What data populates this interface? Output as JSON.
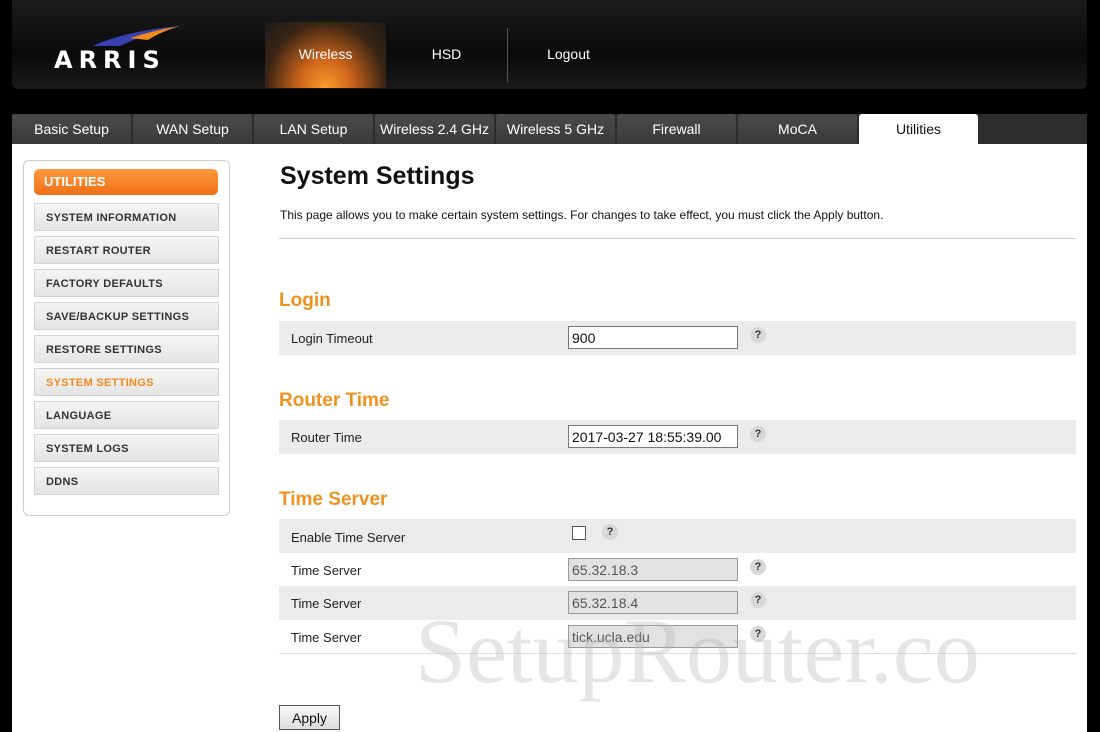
{
  "brand": {
    "logo_text": "ARRIS",
    "accent_color": "#f0911e"
  },
  "top_nav": [
    {
      "label": "Wireless",
      "active": true
    },
    {
      "label": "HSD",
      "active": false
    },
    {
      "label": "Logout",
      "active": false
    }
  ],
  "tabs": [
    {
      "label": "Basic Setup",
      "active": false
    },
    {
      "label": "WAN Setup",
      "active": false
    },
    {
      "label": "LAN Setup",
      "active": false
    },
    {
      "label": "Wireless 2.4 GHz",
      "active": false
    },
    {
      "label": "Wireless 5 GHz",
      "active": false
    },
    {
      "label": "Firewall",
      "active": false
    },
    {
      "label": "MoCA",
      "active": false
    },
    {
      "label": "Utilities",
      "active": true
    }
  ],
  "sidebar": {
    "heading": "UTILITIES",
    "items": [
      {
        "label": "SYSTEM INFORMATION",
        "active": false
      },
      {
        "label": "RESTART ROUTER",
        "active": false
      },
      {
        "label": "FACTORY DEFAULTS",
        "active": false
      },
      {
        "label": "SAVE/BACKUP SETTINGS",
        "active": false
      },
      {
        "label": "RESTORE SETTINGS",
        "active": false
      },
      {
        "label": "SYSTEM SETTINGS",
        "active": true
      },
      {
        "label": "LANGUAGE",
        "active": false
      },
      {
        "label": "SYSTEM LOGS",
        "active": false
      },
      {
        "label": "DDNS",
        "active": false
      }
    ]
  },
  "main": {
    "title": "System Settings",
    "description": "This page allows you to make certain system settings. For changes to take effect, you must click the Apply button.",
    "login": {
      "heading": "Login",
      "timeout_label": "Login Timeout",
      "timeout_value": "900"
    },
    "router_time": {
      "heading": "Router Time",
      "label": "Router Time",
      "value": "2017-03-27 18:55:39.00"
    },
    "time_server": {
      "heading": "Time Server",
      "enable_label": "Enable Time Server",
      "enabled": false,
      "servers": [
        {
          "label": "Time Server",
          "value": "65.32.18.3"
        },
        {
          "label": "Time Server",
          "value": "65.32.18.4"
        },
        {
          "label": "Time Server",
          "value": "tick.ucla.edu"
        }
      ]
    },
    "help_glyph": "?",
    "apply_label": "Apply"
  },
  "watermark": "SetupRouter.co"
}
